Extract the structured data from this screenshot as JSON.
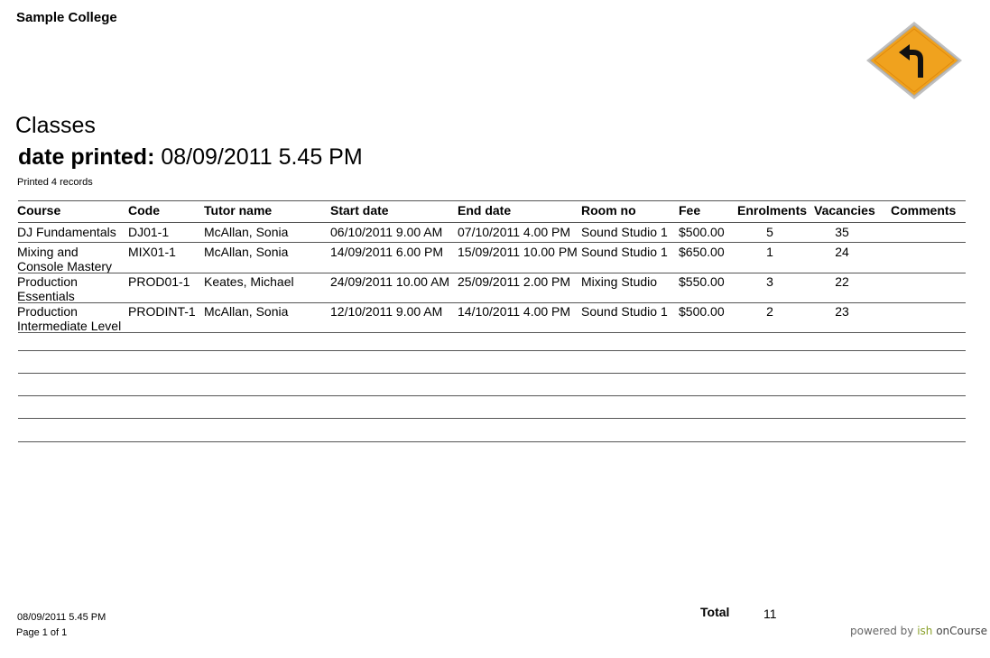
{
  "header": {
    "college": "Sample College",
    "title": "Classes",
    "date_printed_label": "date printed:",
    "date_printed_value": "08/09/2011 5.45 PM",
    "records": "Printed 4 records"
  },
  "logo": {
    "icon": "turn-left-road-sign-icon",
    "color": "#f0a21e",
    "border_color": "#c6c6c6"
  },
  "table": {
    "columns": [
      "Course",
      "Code",
      "Tutor name",
      "Start date",
      "End date",
      "Room no",
      "Fee",
      "Enrolments",
      "Vacancies",
      "Comments"
    ],
    "rows": [
      [
        "DJ Fundamentals",
        "DJ01-1",
        "McAllan, Sonia",
        "06/10/2011 9.00 AM",
        "07/10/2011 4.00 PM",
        "Sound Studio 1",
        "$500.00",
        "5",
        "35",
        ""
      ],
      [
        "Mixing and Console Mastery",
        "MIX01-1",
        "McAllan, Sonia",
        "14/09/2011 6.00 PM",
        "15/09/2011 10.00 PM",
        "Sound Studio 1",
        "$650.00",
        "1",
        "24",
        ""
      ],
      [
        "Production Essentials",
        "PROD01-1",
        "Keates, Michael",
        "24/09/2011 10.00 AM",
        "25/09/2011 2.00 PM",
        "Mixing Studio",
        "$550.00",
        "3",
        "22",
        ""
      ],
      [
        "Production Intermediate Level",
        "PRODINT-1",
        "McAllan, Sonia",
        "12/10/2011 9.00 AM",
        "14/10/2011 4.00 PM",
        "Sound Studio 1",
        "$500.00",
        "2",
        "23",
        ""
      ]
    ]
  },
  "footer": {
    "date": "08/09/2011 5.45 PM",
    "page": "Page 1 of  1",
    "total_label": "Total",
    "total_value": "11",
    "powered_prefix": "powered by ",
    "powered_ish": "ish",
    "powered_brand": " onCourse"
  }
}
